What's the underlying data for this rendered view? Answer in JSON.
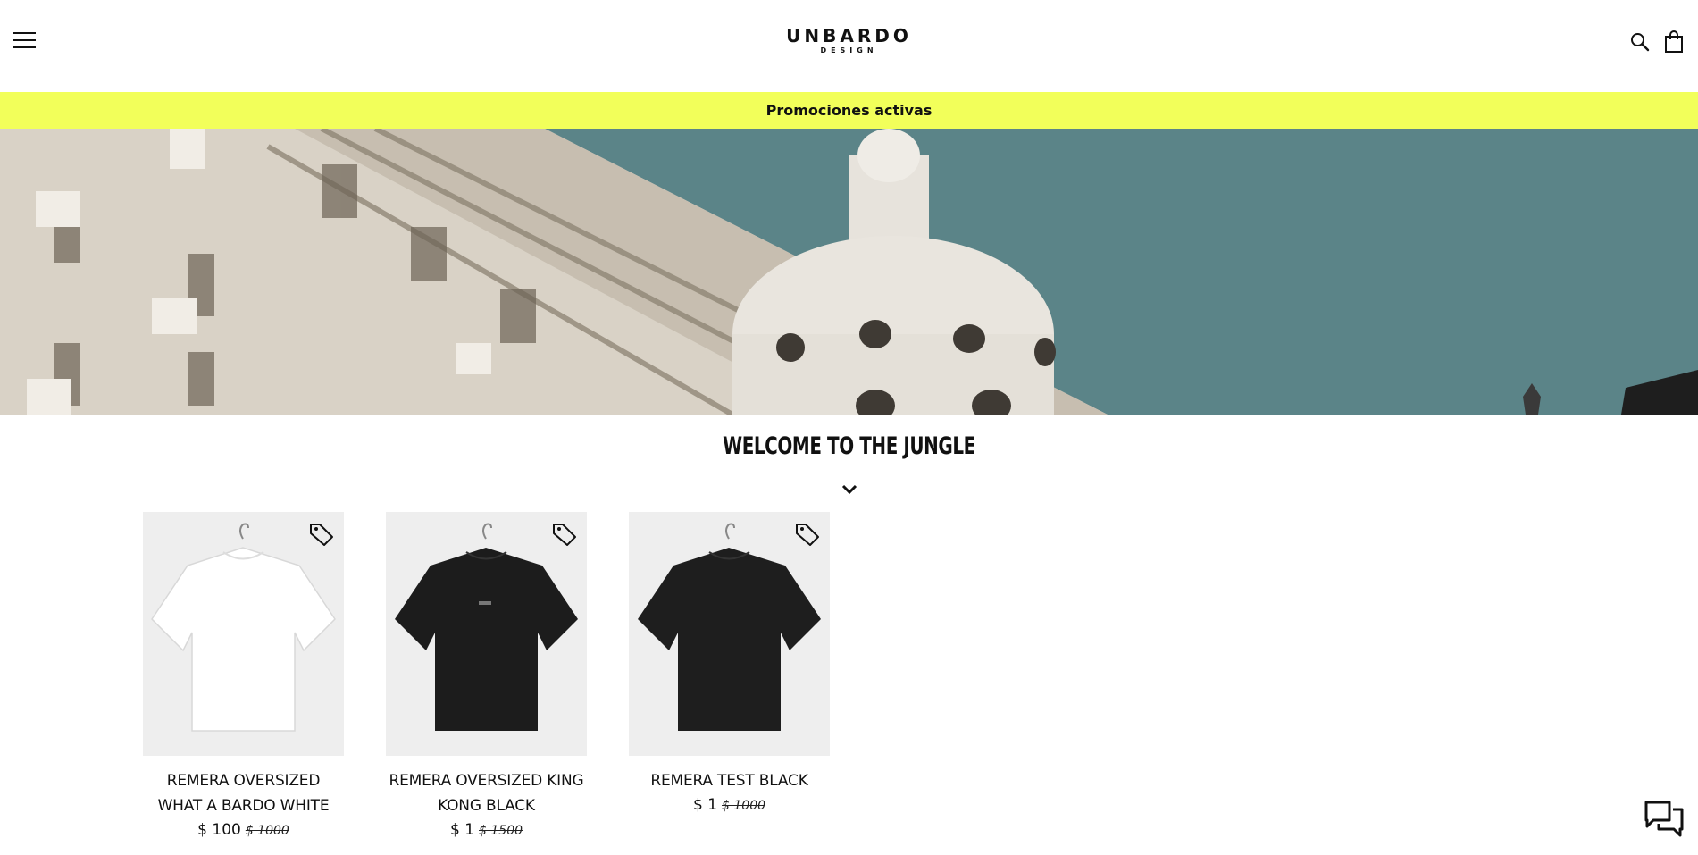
{
  "header": {
    "logo_text": "UNBARDO",
    "logo_subtext": "DESIGN",
    "menu_icon": "hamburger-menu-icon",
    "search_icon": "search-icon",
    "cart_icon": "shopping-bag-icon"
  },
  "promo": {
    "label": "Promociones activas",
    "background": "#f2ff5a"
  },
  "section": {
    "title": "WELCOME TO THE JUNGLE",
    "chevron_icon": "chevron-down-icon"
  },
  "products": [
    {
      "name": "REMERA OVERSIZED WHAT A BARDO WHITE",
      "price": "$ 100",
      "old_price": "$ 1000",
      "shirt_color": "#ffffff",
      "tag_icon": "sale-tag-icon"
    },
    {
      "name": "REMERA OVERSIZED KING KONG BLACK",
      "price": "$ 1",
      "old_price": "$ 1500",
      "shirt_color": "#1c1c1c",
      "tag_icon": "sale-tag-icon"
    },
    {
      "name": "REMERA TEST BLACK",
      "price": "$ 1",
      "old_price": "$ 1000",
      "shirt_color": "#1e1e1e",
      "tag_icon": "sale-tag-icon"
    }
  ],
  "chat": {
    "icon": "chat-bubbles-icon"
  }
}
